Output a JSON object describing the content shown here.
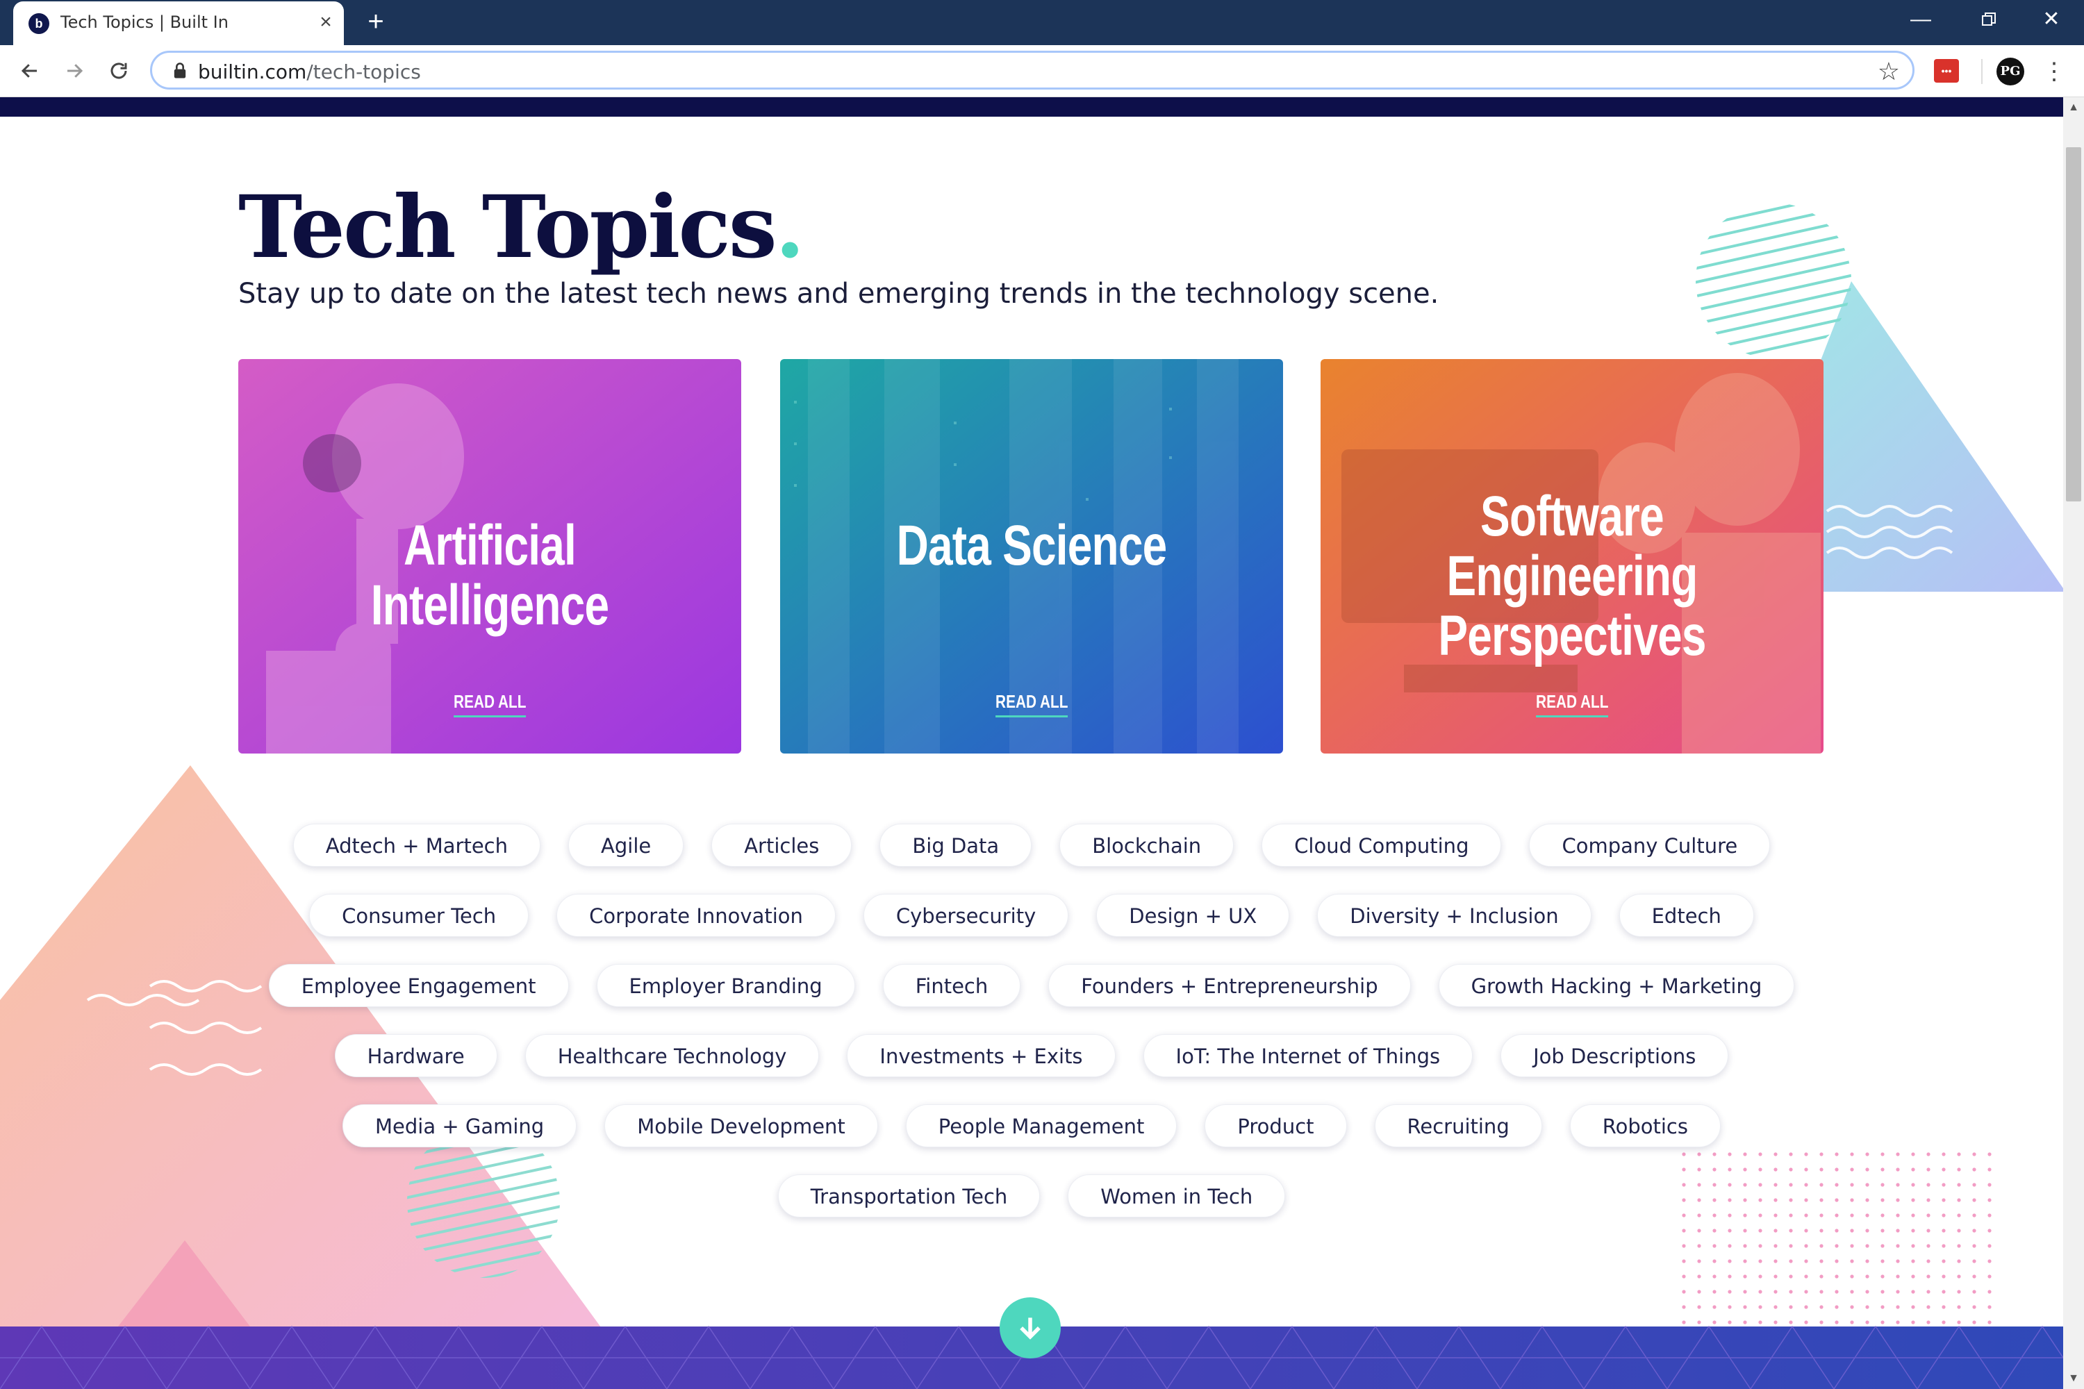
{
  "browser": {
    "tab_title": "Tech Topics | Built In",
    "favicon_letter": "b",
    "new_tab": "+",
    "url_host": "builtin.com",
    "url_path": "/tech-topics",
    "profile_initials": "PG",
    "extension_label": "•••"
  },
  "page": {
    "title": "Tech Topics",
    "title_dot": ".",
    "subtitle": "Stay up to date on the latest tech news and emerging trends in the technology scene."
  },
  "cards": [
    {
      "title": "Artificial Intelligence",
      "link": "READ ALL"
    },
    {
      "title": "Data Science",
      "link": "READ ALL"
    },
    {
      "title_line1": "Software Engineering",
      "title_line2": "Perspectives",
      "link": "READ ALL"
    }
  ],
  "tag_rows": [
    [
      "Adtech + Martech",
      "Agile",
      "Articles",
      "Big Data",
      "Blockchain",
      "Cloud Computing",
      "Company Culture"
    ],
    [
      "Consumer Tech",
      "Corporate Innovation",
      "Cybersecurity",
      "Design + UX",
      "Diversity + Inclusion",
      "Edtech"
    ],
    [
      "Employee Engagement",
      "Employer Branding",
      "Fintech",
      "Founders + Entrepreneurship",
      "Growth Hacking + Marketing"
    ],
    [
      "Hardware",
      "Healthcare Technology",
      "Investments + Exits",
      "IoT: The Internet of Things",
      "Job Descriptions"
    ],
    [
      "Media + Gaming",
      "Mobile Development",
      "People Management",
      "Product",
      "Recruiting",
      "Robotics"
    ],
    [
      "Transportation Tech",
      "Women in Tech"
    ]
  ],
  "colors": {
    "accent": "#4ed7be",
    "navy": "#0d0f3f",
    "chrome": "#1c3458"
  },
  "icons": {
    "back": "arrow-left-icon",
    "forward": "arrow-right-icon",
    "reload": "reload-icon",
    "lock": "lock-icon",
    "bookmark": "star-icon",
    "menu": "kebab-icon",
    "scroll_down": "arrow-down-icon"
  }
}
